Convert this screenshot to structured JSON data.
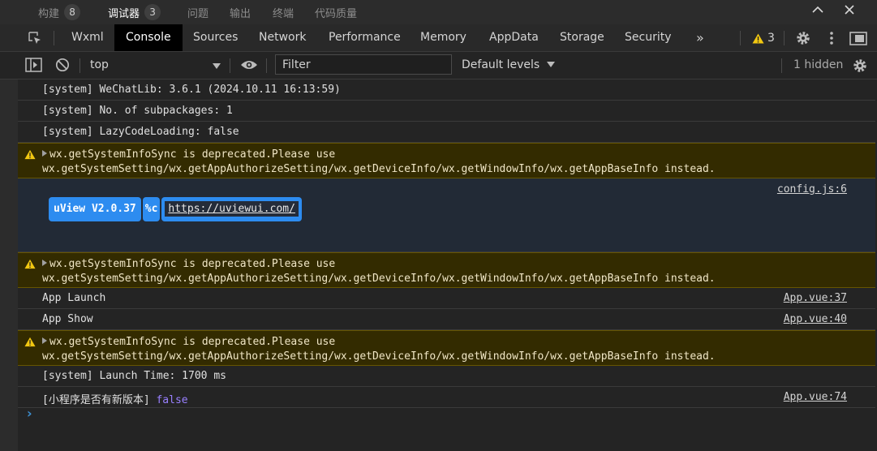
{
  "panel_tabs": [
    {
      "label": "构建",
      "badge": "8"
    },
    {
      "label": "调试器",
      "badge": "3"
    },
    {
      "label": "问题"
    },
    {
      "label": "输出"
    },
    {
      "label": "终端"
    },
    {
      "label": "代码质量"
    }
  ],
  "window_controls": {
    "collapse_icon": "chevron-up-icon",
    "close_icon": "close-icon"
  },
  "devtools_tabs": [
    "Wxml",
    "Console",
    "Sources",
    "Network",
    "Performance",
    "Memory",
    "AppData",
    "Storage",
    "Security"
  ],
  "devtools_right": {
    "warning_count": "3"
  },
  "toolbar": {
    "context": "top",
    "filter_placeholder": "Filter",
    "levels": "Default levels",
    "hidden": "1 hidden"
  },
  "logs": {
    "r1": "[system] WeChatLib: 3.6.1 (2024.10.11 16:13:59)",
    "r2": "[system] No. of subpackages: 1",
    "r3": "[system] LazyCodeLoading: false",
    "warn_l1": "wx.getSystemInfoSync is deprecated.Please use",
    "warn_l2": "wx.getSystemSetting/wx.getAppAuthorizeSetting/wx.getDeviceInfo/wx.getWindowInfo/wx.getAppBaseInfo instead.",
    "uview_src": "config.js:6",
    "uview_label": "uView V2.0.37",
    "uview_fmt": "%c",
    "uview_url": "https://uviewui.com/",
    "app_launch": "App Launch",
    "app_launch_src": "App.vue:37",
    "app_show": "App Show",
    "app_show_src": "App.vue:40",
    "launch_time": "[system] Launch Time: 1700 ms",
    "new_version_label": "[小程序是否有新版本]",
    "new_version_value": "false",
    "new_version_src": "App.vue:74"
  },
  "colors": {
    "accent": "#2d8cf0",
    "warning_bg": "#332b00",
    "warning_border": "#665500",
    "false_value": "#9980ff"
  }
}
